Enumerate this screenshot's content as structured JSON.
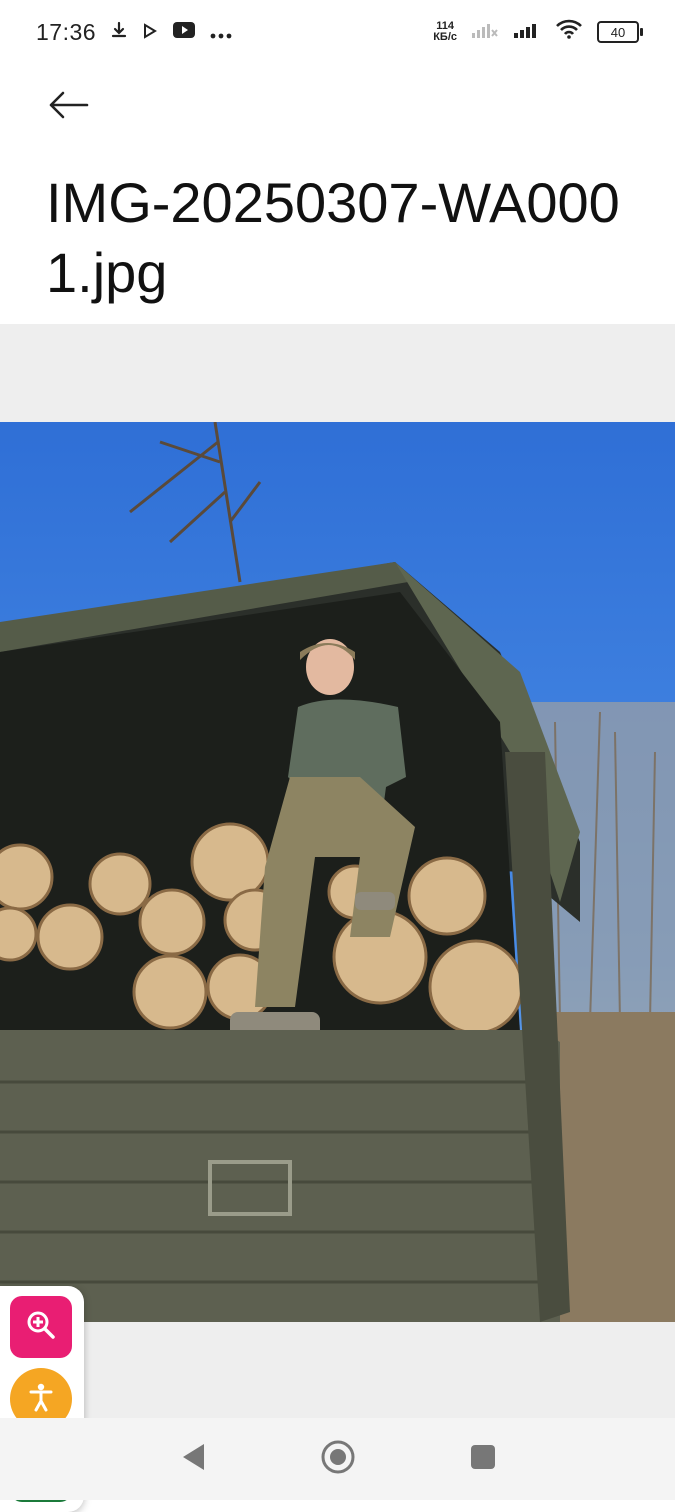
{
  "status_bar": {
    "time": "17:36",
    "net_speed_value": "114",
    "net_speed_unit": "КБ/с",
    "battery": "40",
    "left_icons": [
      "download-icon",
      "play-store-icon",
      "youtube-icon",
      "more-dots-icon"
    ],
    "right_icons": [
      "signal-icon-no-service",
      "signal-icon",
      "wifi-icon",
      "battery-icon"
    ]
  },
  "header": {
    "back_icon": "arrow-left-icon",
    "title": "IMG-20250307-WA0001.jpg"
  },
  "viewer": {
    "background": "#eeeeee"
  },
  "floating_panel": {
    "buttons": [
      {
        "icon": "zoom-in-icon",
        "color": "#e91e73"
      },
      {
        "icon": "accessibility-icon",
        "color": "#f5a623"
      },
      {
        "icon": "exit-icon",
        "color": "#1b7a3a"
      }
    ]
  },
  "nav_bar": {
    "icons": [
      "back-triangle-icon",
      "home-circle-icon",
      "recents-square-icon"
    ]
  }
}
